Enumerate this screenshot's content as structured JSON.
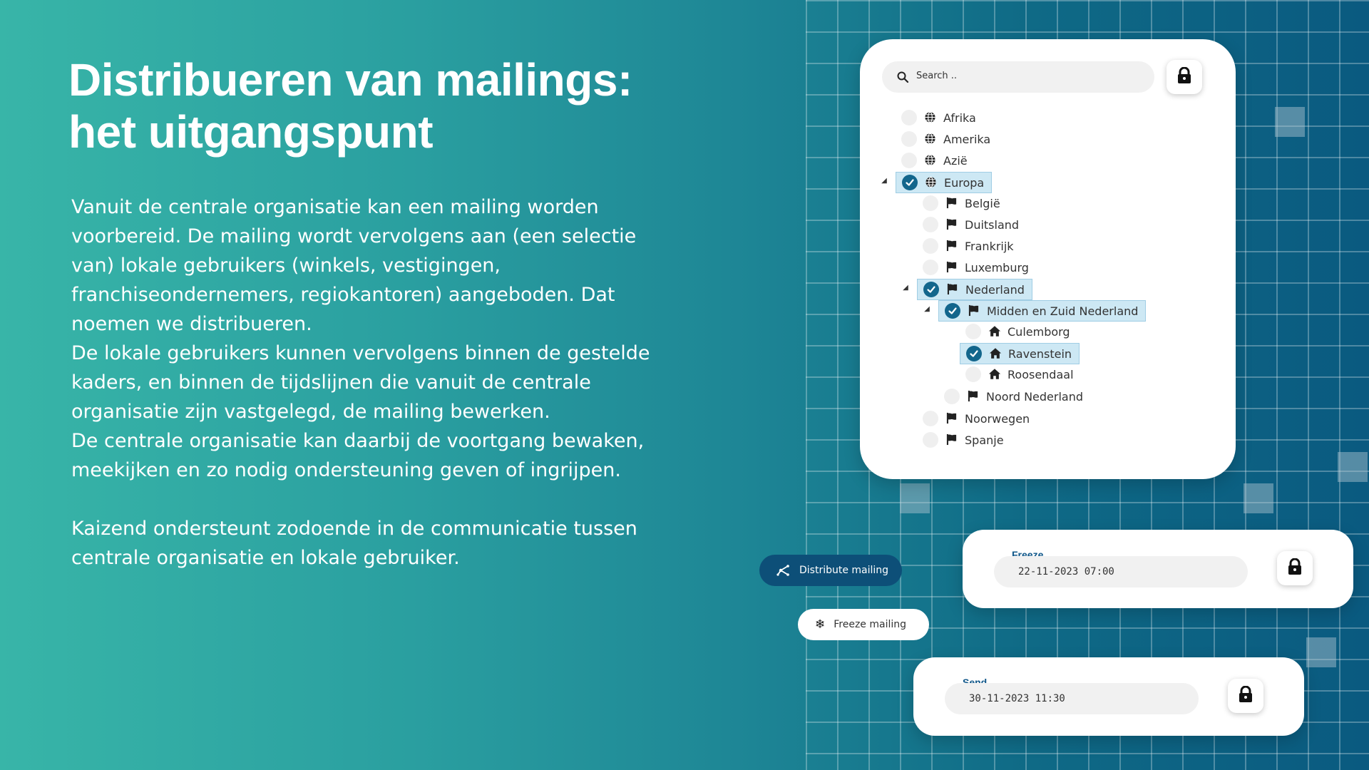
{
  "slide": {
    "title": "Distribueren van mailings: het uitgangspunt",
    "paragraph_1": "Vanuit de centrale organisatie kan een mailing worden voorbereid. De mailing wordt vervolgens aan (een selectie van) lokale gebruikers (winkels, vestigingen, franchiseondernemers, regiokantoren) aangeboden. Dat noemen we distribueren.",
    "paragraph_2a": "De lokale gebruikers kunnen vervolgens binnen de gestelde kaders, en binnen de tijdslijnen die vanuit de centrale organisatie zijn vastgelegd, de mailing bewerken.",
    "paragraph_2b": "De centrale organisatie kan daarbij de voortgang bewaken, meekijken en zo nodig ondersteuning geven of ingrijpen.",
    "paragraph_3": "Kaizend ondersteunt zodoende in de communicatie tussen centrale organisatie en lokale gebruiker."
  },
  "tree_panel": {
    "search_placeholder": "Search ..",
    "lock_icon": "lock-icon",
    "items": [
      {
        "label": "Afrika",
        "icon": "globe-icon",
        "checked": false,
        "expanded": null,
        "level": 0
      },
      {
        "label": "Amerika",
        "icon": "globe-icon",
        "checked": false,
        "expanded": null,
        "level": 0
      },
      {
        "label": "Azië",
        "icon": "globe-icon",
        "checked": false,
        "expanded": null,
        "level": 0
      },
      {
        "label": "Europa",
        "icon": "globe-icon",
        "checked": true,
        "expanded": true,
        "level": 0
      },
      {
        "label": "België",
        "icon": "flag-icon",
        "checked": false,
        "expanded": null,
        "level": 1
      },
      {
        "label": "Duitsland",
        "icon": "flag-icon",
        "checked": false,
        "expanded": null,
        "level": 1
      },
      {
        "label": "Frankrijk",
        "icon": "flag-icon",
        "checked": false,
        "expanded": null,
        "level": 1
      },
      {
        "label": "Luxemburg",
        "icon": "flag-icon",
        "checked": false,
        "expanded": null,
        "level": 1
      },
      {
        "label": "Nederland",
        "icon": "flag-icon",
        "checked": true,
        "expanded": true,
        "level": 1
      },
      {
        "label": "Midden en Zuid Nederland",
        "icon": "flag-icon",
        "checked": true,
        "expanded": true,
        "level": 2
      },
      {
        "label": "Culemborg",
        "icon": "home-icon",
        "checked": false,
        "expanded": null,
        "level": 3
      },
      {
        "label": "Ravenstein",
        "icon": "home-icon",
        "checked": true,
        "expanded": null,
        "level": 3
      },
      {
        "label": "Roosendaal",
        "icon": "home-icon",
        "checked": false,
        "expanded": null,
        "level": 3
      },
      {
        "label": "Noord Nederland",
        "icon": "flag-icon",
        "checked": false,
        "expanded": null,
        "level": 2
      },
      {
        "label": "Noorwegen",
        "icon": "flag-icon",
        "checked": false,
        "expanded": null,
        "level": 1
      },
      {
        "label": "Spanje",
        "icon": "flag-icon",
        "checked": false,
        "expanded": null,
        "level": 1
      }
    ]
  },
  "actions": {
    "distribute_label": "Distribute mailing",
    "freeze_label": "Freeze mailing"
  },
  "freeze_card": {
    "label": "Freeze",
    "value": "22-11-2023  07:00"
  },
  "send_card": {
    "label": "Send",
    "value": "30-11-2023  11:30"
  },
  "colors": {
    "accent": "#13668c",
    "selection_bg": "#cde8f4",
    "dark_button": "#0d4f78",
    "label_blue": "#11588a"
  }
}
